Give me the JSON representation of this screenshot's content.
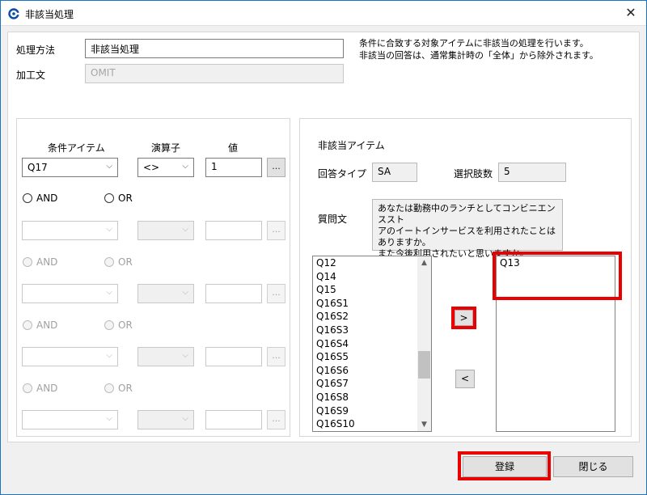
{
  "window": {
    "title": "非該当処理",
    "close_glyph": "✕"
  },
  "top": {
    "method_label": "処理方法",
    "method_value": "非該当処理",
    "expression_label": "加工文",
    "expression_value": "OMIT",
    "notice_line1": "条件に合致する対象アイテムに非該当の処理を行います。",
    "notice_line2": "非該当の回答は、通常集計時の「全体」から除外されます。"
  },
  "conditions": {
    "col_item": "条件アイテム",
    "col_operator": "演算子",
    "col_value": "値",
    "row1": {
      "item": "Q17",
      "operator": "<>",
      "value": "1"
    },
    "browse_label": "...",
    "and_label": "AND",
    "or_label": "OR"
  },
  "target": {
    "section_title": "非該当アイテム",
    "answer_type_label": "回答タイプ",
    "answer_type_value": "SA",
    "choices_label": "選択肢数",
    "choices_value": "5",
    "question_label": "質問文",
    "question_line1": "あなたは勤務中のランチとしてコンビニエンススト",
    "question_line2": "アのイートインサービスを利用されたことはありますか。",
    "question_line3": "また今後利用されたいと思いますか。",
    "available_items": [
      "Q12",
      "Q14",
      "Q15",
      "Q16S1",
      "Q16S2",
      "Q16S3",
      "Q16S4",
      "Q16S5",
      "Q16S6",
      "Q16S7",
      "Q16S8",
      "Q16S9",
      "Q16S10"
    ],
    "selected_items": [
      "Q13"
    ],
    "add_button": ">",
    "remove_button": "<"
  },
  "footer": {
    "register_label": "登録",
    "close_label": "閉じる"
  }
}
